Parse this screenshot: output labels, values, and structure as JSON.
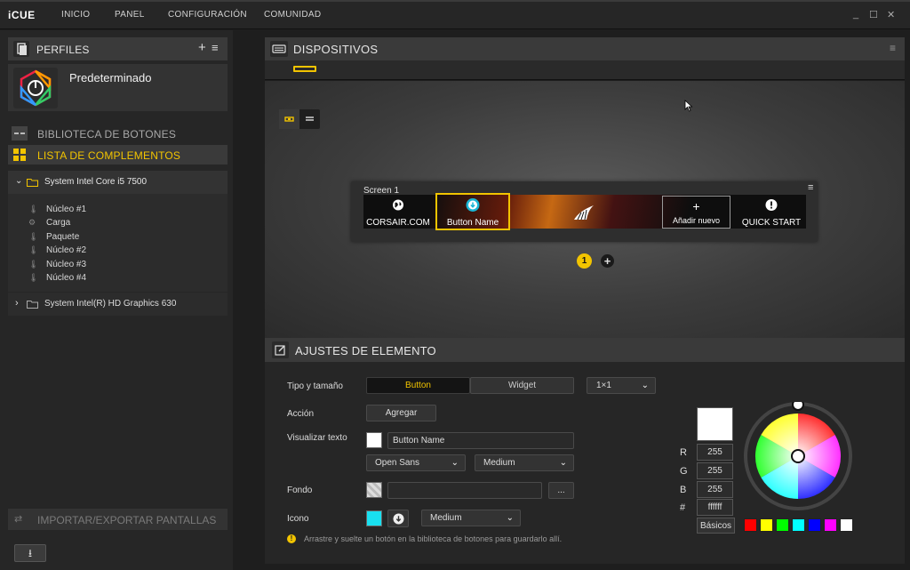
{
  "app": {
    "logo": "iCUE"
  },
  "nav": [
    {
      "label": "INICIO"
    },
    {
      "label": "PANEL"
    },
    {
      "label": "CONFIGURACIÓN"
    },
    {
      "label": "COMUNIDAD"
    }
  ],
  "window_controls": {
    "minimize": "_",
    "maximize": "☐",
    "close": "✕"
  },
  "profiles": {
    "title": "PERFILES",
    "add": "+",
    "menu": "≡",
    "items": [
      {
        "name": "Predeterminado"
      }
    ]
  },
  "library": {
    "title": "BIBLIOTECA DE BOTONES"
  },
  "plugins": {
    "title": "LISTA DE COMPLEMENTOS"
  },
  "tree": {
    "groups": [
      {
        "label": "System Intel Core i5 7500",
        "expanded": true,
        "sensors": [
          "Núcleo #1",
          "Carga",
          "Paquete",
          "Núcleo #2",
          "Núcleo #3",
          "Núcleo #4"
        ]
      },
      {
        "label": "System Intel(R) HD Graphics 630",
        "expanded": false,
        "sensors": []
      }
    ]
  },
  "import_export": {
    "title": "IMPORTAR/EXPORTAR PANTALLAS"
  },
  "download": {
    "icon": "download-icon",
    "glyph": "⭳"
  },
  "devices": {
    "title": "DISPOSITIVOS"
  },
  "screen": {
    "title": "Screen 1",
    "slots": [
      {
        "label": "CORSAIR.COM",
        "icon": "globe-icon"
      },
      {
        "label": "Button Name",
        "icon": "download-circle-icon",
        "selected": true
      },
      {
        "label": "",
        "icon": "corsair-logo-icon"
      },
      {
        "label": "Añadir nuevo",
        "icon": "plus-icon",
        "glyph": "+"
      },
      {
        "label": "QUICK START",
        "icon": "info-icon"
      }
    ],
    "pages": [
      {
        "label": "1",
        "active": true
      },
      {
        "label": "+",
        "active": false
      }
    ]
  },
  "settings": {
    "title": "AJUSTES DE ELEMENTO",
    "type_label": "Tipo y tamaño",
    "type_options": [
      "Button",
      "Widget"
    ],
    "type_selected": "Button",
    "size": "1×1",
    "action_label": "Acción",
    "action_button": "Agregar",
    "display_label": "Visualizar texto",
    "display_text": "Button Name",
    "font": "Open Sans",
    "weight": "Medium",
    "background_label": "Fondo",
    "background_value": "",
    "browse": "...",
    "icon_label": "Icono",
    "icon_size": "Medium",
    "hint": "Arrastre y suelte un botón en la biblioteca de botones para guardarlo allí."
  },
  "color": {
    "r_label": "R",
    "g_label": "G",
    "b_label": "B",
    "hex_label": "#",
    "r": "255",
    "g": "255",
    "b": "255",
    "hex": "ffffff",
    "basics": "Básicos",
    "current": "#ffffff",
    "presets": [
      "#ff0000",
      "#ffff00",
      "#00ff00",
      "#00ffff",
      "#0000ff",
      "#ff00ff",
      "#ffffff"
    ]
  },
  "accent": "#f2c400"
}
